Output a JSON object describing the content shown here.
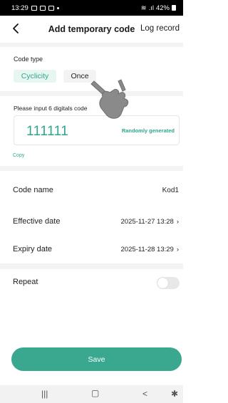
{
  "status_bar": {
    "time": "13:29",
    "battery": "42%"
  },
  "header": {
    "title": "Add temporary code",
    "log_record": "Log record"
  },
  "code_type": {
    "label": "Code type",
    "options": [
      "Cyclicity",
      "Once"
    ],
    "selected": "Cyclicity"
  },
  "code_input": {
    "prompt": "Please input 6 digitals code",
    "value": "111111",
    "random_label": "Randomly generated",
    "copy_label": "Copy"
  },
  "fields": {
    "code_name": {
      "label": "Code name",
      "value": "Kod1"
    },
    "effective_date": {
      "label": "Effective date",
      "value": "2025-11-27 13:28"
    },
    "expiry_date": {
      "label": "Expiry date",
      "value": "2025-11-28 13:29"
    },
    "repeat": {
      "label": "Repeat",
      "enabled": false
    }
  },
  "save_label": "Save",
  "colors": {
    "accent": "#3aa88e",
    "accent_light": "#e7f6f1"
  },
  "icons": {
    "back": "chevron-left-icon",
    "chevron": "chevron-right-icon",
    "pointer": "hand-pointer-icon"
  }
}
